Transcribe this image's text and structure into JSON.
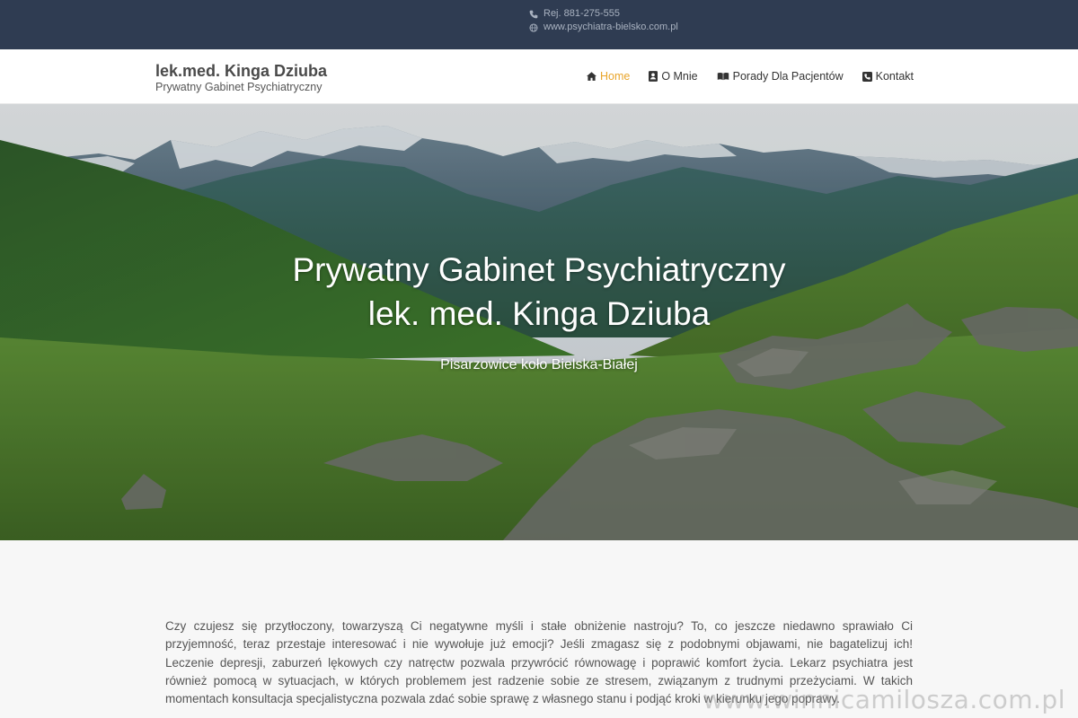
{
  "topbar": {
    "phone": "Rej. 881-275-555",
    "website": "www.psychiatra-bielsko.com.pl",
    "phone_icon": "phone-icon",
    "globe_icon": "globe-icon"
  },
  "header": {
    "brand_name": "lek.med. Kinga Dziuba",
    "brand_sub": "Prywatny Gabinet Psychiatryczny"
  },
  "nav": {
    "items": [
      {
        "label": "Home",
        "icon": "home-icon",
        "active": true
      },
      {
        "label": "O Mnie",
        "icon": "id-card-icon",
        "active": false
      },
      {
        "label": "Porady Dla Pacjentów",
        "icon": "book-icon",
        "active": false
      },
      {
        "label": "Kontakt",
        "icon": "phone-square-icon",
        "active": false
      }
    ]
  },
  "hero": {
    "title_line1": "Prywatny Gabinet Psychiatryczny",
    "title_line2": "lek. med. Kinga Dziuba",
    "tagline": "Pisarzowice koło Bielska-Białej"
  },
  "content": {
    "paragraph": "Czy czujesz się przytłoczony, towarzyszą Ci negatywne myśli i stałe obniżenie nastroju? To, co jeszcze niedawno sprawiało Ci przyjemność, teraz przestaje interesować i nie wywołuje już emocji? Jeśli zmagasz się z podobnymi objawami, nie bagatelizuj ich! Leczenie depresji, zaburzeń lękowych czy natręctw pozwala przywrócić równowagę i poprawić komfort życia. Lekarz psychiatra jest również pomocą w sytuacjach, w których problemem jest radzenie sobie ze stresem, związanym z trudnymi przeżyciami. W takich momentach konsultacja specjalistyczna pozwala zdać sobie sprawę z własnego stanu i podjąć kroki w kierunku jego poprawy."
  },
  "watermark": "www.winnicamilosza.com.pl",
  "colors": {
    "topbar_bg": "#2f3c52",
    "nav_active": "#e9a52a",
    "text": "#555555"
  }
}
